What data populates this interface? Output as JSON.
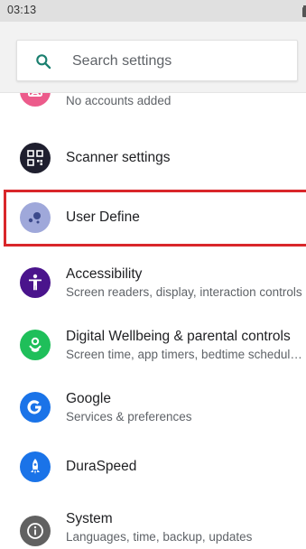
{
  "status_bar": {
    "time": "03:13"
  },
  "search": {
    "placeholder": "Search settings"
  },
  "settings": [
    {
      "id": "accounts",
      "title": "",
      "subtitle": "No accounts added",
      "icon": "account-icon",
      "color": "#ec5b8b"
    },
    {
      "id": "scanner",
      "title": "Scanner settings",
      "subtitle": "",
      "icon": "qr-code-icon",
      "color": "#1f1f2e"
    },
    {
      "id": "user-define",
      "title": "User Define",
      "subtitle": "",
      "icon": "dots-icon",
      "color": "#9fa8da"
    },
    {
      "id": "accessibility",
      "title": "Accessibility",
      "subtitle": "Screen readers, display, interaction controls",
      "icon": "accessibility-icon",
      "color": "#4a148c"
    },
    {
      "id": "wellbeing",
      "title": "Digital Wellbeing & parental controls",
      "subtitle": "Screen time, app timers, bedtime schedul…",
      "icon": "wellbeing-icon",
      "color": "#1fbf5a"
    },
    {
      "id": "google",
      "title": "Google",
      "subtitle": "Services & preferences",
      "icon": "google-icon",
      "color": "#1a73e8"
    },
    {
      "id": "duraspeed",
      "title": "DuraSpeed",
      "subtitle": "",
      "icon": "rocket-icon",
      "color": "#1a73e8"
    },
    {
      "id": "system",
      "title": "System",
      "subtitle": "Languages, time, backup, updates",
      "icon": "info-icon",
      "color": "#616161"
    }
  ],
  "accent_color": "#1a7f6f",
  "highlight_color": "#d9262a"
}
